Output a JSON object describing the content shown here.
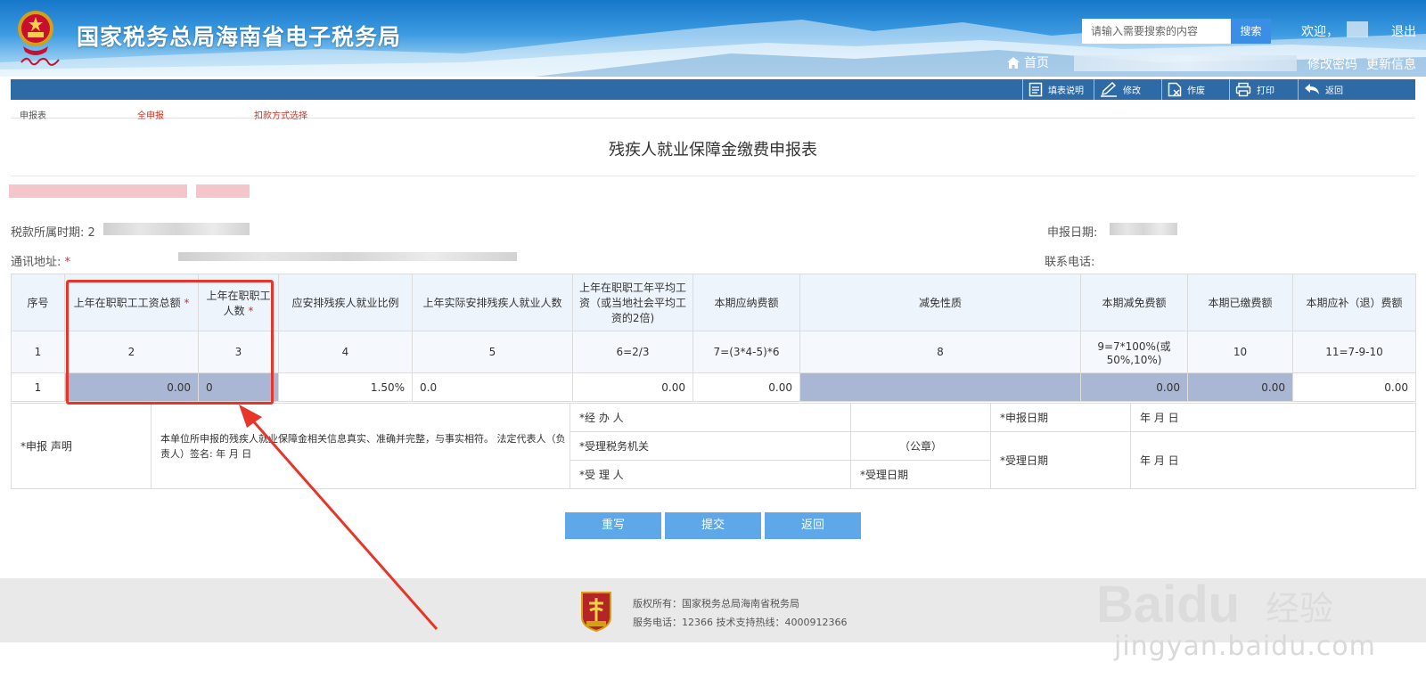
{
  "header": {
    "site_title": "国家税务总局海南省电子税务局",
    "search_placeholder": "请输入需要搜索的内容",
    "search_button": "搜索",
    "welcome": "欢迎，",
    "logout": "退出",
    "home": "首页",
    "change_password": "修改密码",
    "update_info": "更新信息"
  },
  "toolbar": {
    "items": [
      {
        "label": "填表说明",
        "icon": "document-icon"
      },
      {
        "label": "修改",
        "icon": "pencil-icon"
      },
      {
        "label": "作废",
        "icon": "void-icon"
      },
      {
        "label": "打印",
        "icon": "printer-icon"
      },
      {
        "label": "返回",
        "icon": "return-icon"
      }
    ]
  },
  "subnav": {
    "report_table": "申报表",
    "full_report": "全申报",
    "deduction_method": "扣款方式选择"
  },
  "form": {
    "title": "残疾人就业保障金缴费申报表",
    "tax_period_label": "税款所属时期:",
    "tax_period_prefix": "2",
    "report_date_label": "申报日期:",
    "address_label": "通讯地址:",
    "required_mark": "*",
    "phone_label": "联系电话:"
  },
  "table": {
    "headers": [
      "序号",
      "上年在职职工工资总额",
      "上年在职职工人数",
      "应安排残疾人就业比例",
      "上年实际安排残疾人就业人数",
      "上年在职职工年平均工资（或当地社会平均工资的2倍)",
      "本期应纳费额",
      "减免性质",
      "本期减免费额",
      "本期已缴费额",
      "本期应补（退）费额"
    ],
    "formula_row": [
      "1",
      "2",
      "3",
      "4",
      "5",
      "6=2/3",
      "7=(3*4-5)*6",
      "8",
      "9=7*100%(或50%,10%)",
      "10",
      "11=7-9-10"
    ],
    "data_row": [
      "1",
      "0.00",
      "0",
      "1.50%",
      "0.0",
      "0.00",
      "0.00",
      "",
      "0.00",
      "0.00",
      "0.00"
    ]
  },
  "declaration": {
    "label": "*申报 声明",
    "text": "本单位所申报的残疾人就业保障金相关信息真实、准确并完整，与事实相符。 法定代表人（负责人）签名:  年 月 日",
    "handler": "*经 办 人",
    "tax_authority": "*受理税务机关",
    "seal": "（公章）",
    "receiver": "*受 理 人",
    "receive_date": "*受理日期",
    "report_date": "*申报日期",
    "report_date_value": "年 月 日",
    "receive_date_right": "*受理日期",
    "receive_date_value": "年 月 日"
  },
  "buttons": {
    "reset": "重写",
    "submit": "提交",
    "back": "返回"
  },
  "footer": {
    "copyright": "版权所有：国家税务总局海南省税务局",
    "service": "服务电话：12366 技术支持热线：4000912366"
  },
  "watermark": {
    "brand": "Baidu",
    "suffix": "经验",
    "url": "jingyan.baidu.com"
  },
  "colors": {
    "header_blue": "#1677c9",
    "toolbar": "#2e6aa6",
    "button": "#5ea8ea",
    "readonly_cell": "#a9b7d4",
    "highlight": "#e8352a",
    "subnav_red": "#c0392b"
  }
}
